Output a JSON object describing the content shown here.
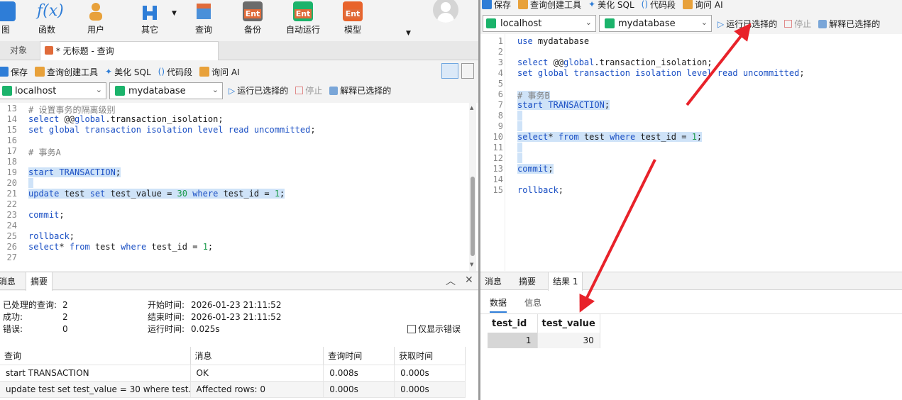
{
  "left": {
    "ribbon": [
      {
        "label": "图",
        "color": "#2e7dd7"
      },
      {
        "label": "函数",
        "color": "#2e7dd7"
      },
      {
        "label": "用户",
        "color": "#e8a13a"
      },
      {
        "label": "其它",
        "color": "#2e7dd7"
      },
      {
        "label": "查询",
        "color": "#e06b3a"
      },
      {
        "label": "备份",
        "color": "#e06b3a"
      },
      {
        "label": "自动运行",
        "color": "#1bb36b"
      },
      {
        "label": "模型",
        "color": "#e8632b"
      }
    ],
    "ent_label": "Ent",
    "tabs": {
      "objects": "对象",
      "query": "* 无标题 - 查询"
    },
    "toolbar": {
      "save": "保存",
      "builder": "查询创建工具",
      "beautify": "美化 SQL",
      "snippet": "代码段",
      "ai": "询问 AI"
    },
    "connection": {
      "host": "localhost",
      "db": "mydatabase",
      "run": "运行已选择的",
      "stop": "停止",
      "explain": "解释已选择的"
    },
    "editor_lines": [
      {
        "n": "13",
        "segs": [
          {
            "t": "# 设置事务的隔离级别",
            "c": "cm"
          }
        ]
      },
      {
        "n": "14",
        "segs": [
          {
            "t": "select ",
            "c": "kw"
          },
          {
            "t": "@@",
            "c": ""
          },
          {
            "t": "global",
            "c": "kw"
          },
          {
            "t": ".transaction_isolation;",
            "c": ""
          }
        ]
      },
      {
        "n": "15",
        "segs": [
          {
            "t": "set global transaction isolation level read uncommitted",
            "c": "kw"
          },
          {
            "t": ";",
            "c": ""
          }
        ]
      },
      {
        "n": "16",
        "segs": []
      },
      {
        "n": "17",
        "segs": [
          {
            "t": "# 事务A",
            "c": "cm"
          }
        ]
      },
      {
        "n": "18",
        "segs": []
      },
      {
        "n": "19",
        "hl": true,
        "segs": [
          {
            "t": "start TRANSACTION",
            "c": "kw"
          },
          {
            "t": ";",
            "c": ""
          }
        ]
      },
      {
        "n": "20",
        "hl": true,
        "segs": [
          {
            "t": " ",
            "c": ""
          }
        ]
      },
      {
        "n": "21",
        "hl": true,
        "segs": [
          {
            "t": "update ",
            "c": "kw"
          },
          {
            "t": "test ",
            "c": ""
          },
          {
            "t": "set ",
            "c": "kw"
          },
          {
            "t": "test_value = ",
            "c": ""
          },
          {
            "t": "30",
            "c": "num"
          },
          {
            "t": " where ",
            "c": "kw"
          },
          {
            "t": "test_id = ",
            "c": ""
          },
          {
            "t": "1",
            "c": "num"
          },
          {
            "t": ";",
            "c": ""
          }
        ]
      },
      {
        "n": "22",
        "segs": []
      },
      {
        "n": "23",
        "segs": [
          {
            "t": "commit",
            "c": "kw"
          },
          {
            "t": ";",
            "c": ""
          }
        ]
      },
      {
        "n": "24",
        "segs": []
      },
      {
        "n": "25",
        "segs": [
          {
            "t": "rollback",
            "c": "kw"
          },
          {
            "t": ";",
            "c": ""
          }
        ]
      },
      {
        "n": "26",
        "segs": [
          {
            "t": "select",
            "c": "kw"
          },
          {
            "t": "* ",
            "c": ""
          },
          {
            "t": "from",
            "c": "kw"
          },
          {
            "t": " test ",
            "c": ""
          },
          {
            "t": "where",
            "c": "kw"
          },
          {
            "t": " test_id = ",
            "c": ""
          },
          {
            "t": "1",
            "c": "num"
          },
          {
            "t": ";",
            "c": ""
          }
        ]
      },
      {
        "n": "27",
        "segs": []
      }
    ],
    "bottom_tabs": {
      "messages": "消息",
      "summary": "摘要"
    },
    "summary": {
      "processed_label": "已处理的查询:",
      "processed": "2",
      "success_label": "成功:",
      "success": "2",
      "errors_label": "错误:",
      "errors": "0",
      "start_label": "开始时间:",
      "start": "2026-01-23 21:11:52",
      "end_label": "结束时间:",
      "end": "2026-01-23 21:11:52",
      "elapsed_label": "运行时间:",
      "elapsed": "0.025s",
      "only_errors": "仅显示错误"
    },
    "result_table": {
      "headers": [
        "查询",
        "消息",
        "查询时间",
        "获取时间"
      ],
      "rows": [
        [
          "start TRANSACTION",
          "OK",
          "0.008s",
          "0.000s"
        ],
        [
          "update test set test_value = 30 where test...",
          "Affected rows: 0",
          "0.000s",
          "0.000s"
        ]
      ]
    }
  },
  "right": {
    "toolbar": {
      "save": "保存",
      "builder": "查询创建工具",
      "beautify": "美化 SQL",
      "snippet": "代码段",
      "ai": "询问 AI"
    },
    "connection": {
      "host": "localhost",
      "db": "mydatabase",
      "run": "运行已选择的",
      "stop": "停止",
      "explain": "解释已选择的"
    },
    "editor_lines": [
      {
        "n": "1",
        "segs": [
          {
            "t": "use ",
            "c": "kw"
          },
          {
            "t": "mydatabase",
            "c": ""
          }
        ]
      },
      {
        "n": "2",
        "segs": []
      },
      {
        "n": "3",
        "segs": [
          {
            "t": "select ",
            "c": "kw"
          },
          {
            "t": "@@",
            "c": ""
          },
          {
            "t": "global",
            "c": "kw"
          },
          {
            "t": ".transaction_isolation;",
            "c": ""
          }
        ]
      },
      {
        "n": "4",
        "segs": [
          {
            "t": "set global transaction isolation level read uncommitted",
            "c": "kw"
          },
          {
            "t": ";",
            "c": ""
          }
        ]
      },
      {
        "n": "5",
        "segs": []
      },
      {
        "n": "6",
        "hl": true,
        "segs": [
          {
            "t": "# 事务B",
            "c": "cm"
          }
        ]
      },
      {
        "n": "7",
        "hl": true,
        "segs": [
          {
            "t": "start TRANSACTION",
            "c": "kw"
          },
          {
            "t": ";",
            "c": ""
          }
        ]
      },
      {
        "n": "8",
        "hl": true,
        "segs": [
          {
            "t": " ",
            "c": ""
          }
        ]
      },
      {
        "n": "9",
        "hl": true,
        "segs": [
          {
            "t": " ",
            "c": ""
          }
        ]
      },
      {
        "n": "10",
        "hl": true,
        "segs": [
          {
            "t": "select",
            "c": "kw"
          },
          {
            "t": "* ",
            "c": ""
          },
          {
            "t": "from",
            "c": "kw"
          },
          {
            "t": " test ",
            "c": ""
          },
          {
            "t": "where",
            "c": "kw"
          },
          {
            "t": " test_id = ",
            "c": ""
          },
          {
            "t": "1",
            "c": "num"
          },
          {
            "t": ";",
            "c": ""
          }
        ]
      },
      {
        "n": "11",
        "hl": true,
        "segs": [
          {
            "t": " ",
            "c": ""
          }
        ]
      },
      {
        "n": "12",
        "hl": true,
        "segs": [
          {
            "t": " ",
            "c": ""
          }
        ]
      },
      {
        "n": "13",
        "hl": true,
        "segs": [
          {
            "t": "commit",
            "c": "kw"
          },
          {
            "t": ";",
            "c": ""
          }
        ]
      },
      {
        "n": "14",
        "segs": []
      },
      {
        "n": "15",
        "segs": [
          {
            "t": "rollback",
            "c": "kw"
          },
          {
            "t": ";",
            "c": ""
          }
        ]
      }
    ],
    "bottom_tabs": {
      "messages": "消息",
      "summary": "摘要",
      "result": "结果 1"
    },
    "sub_tabs": {
      "data": "数据",
      "info": "信息"
    },
    "grid": {
      "headers": [
        "test_id",
        "test_value"
      ],
      "rows": [
        [
          "1",
          "30"
        ]
      ]
    }
  },
  "colors": {
    "arrow": "#e8222a",
    "selection": "#cfe3f8",
    "keyword": "#1a4fc4",
    "number": "#1a9a4a",
    "comment": "#808080"
  }
}
